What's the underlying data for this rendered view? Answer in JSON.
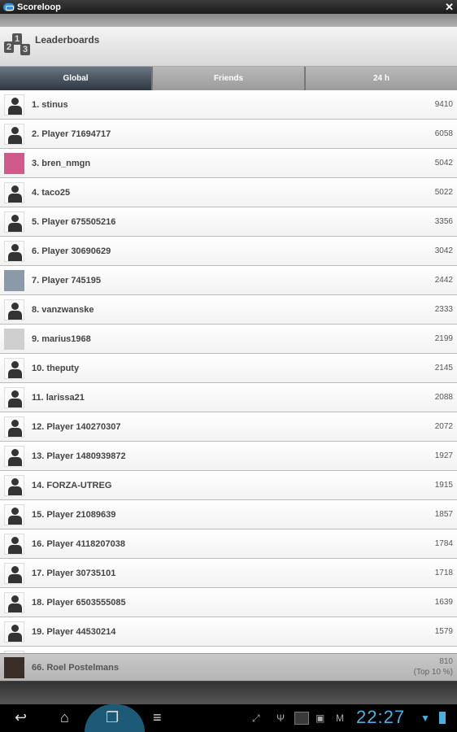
{
  "app": {
    "title": "Scoreloop",
    "close_icon": "close-icon"
  },
  "header": {
    "title": "Leaderboards",
    "icon_digits": [
      "2",
      "1",
      "3"
    ]
  },
  "tabs": [
    {
      "label": "Global",
      "active": true
    },
    {
      "label": "Friends",
      "active": false
    },
    {
      "label": "24 h",
      "active": false
    }
  ],
  "rows": [
    {
      "name": "1. stinus",
      "score": "9410",
      "avatar": "default"
    },
    {
      "name": "2. Player 71694717",
      "score": "6058",
      "avatar": "default"
    },
    {
      "name": "3. bren_nmgn",
      "score": "5042",
      "avatar": "photo",
      "color": "#d05a8a"
    },
    {
      "name": "4. taco25",
      "score": "5022",
      "avatar": "default"
    },
    {
      "name": "5. Player 675505216",
      "score": "3356",
      "avatar": "default"
    },
    {
      "name": "6. Player 30690629",
      "score": "3042",
      "avatar": "default"
    },
    {
      "name": "7. Player 745195",
      "score": "2442",
      "avatar": "photo",
      "color": "#8a9aa8"
    },
    {
      "name": "8. vanzwanske",
      "score": "2333",
      "avatar": "default"
    },
    {
      "name": "9. marius1968",
      "score": "2199",
      "avatar": "photo",
      "color": "#cfcfcf"
    },
    {
      "name": "10. theputy",
      "score": "2145",
      "avatar": "default"
    },
    {
      "name": "11. larissa21",
      "score": "2088",
      "avatar": "default"
    },
    {
      "name": "12. Player 140270307",
      "score": "2072",
      "avatar": "default"
    },
    {
      "name": "13. Player 1480939872",
      "score": "1927",
      "avatar": "default"
    },
    {
      "name": "14. FORZA-UTREG",
      "score": "1915",
      "avatar": "default"
    },
    {
      "name": "15. Player 21089639",
      "score": "1857",
      "avatar": "default"
    },
    {
      "name": "16. Player 4118207038",
      "score": "1784",
      "avatar": "default"
    },
    {
      "name": "17. Player 30735101",
      "score": "1718",
      "avatar": "default"
    },
    {
      "name": "18. Player 6503555085",
      "score": "1639",
      "avatar": "default"
    },
    {
      "name": "19. Player 44530214",
      "score": "1579",
      "avatar": "default"
    }
  ],
  "my_score": {
    "name": "66. Roel Postelmans",
    "score": "810",
    "rank_note": "(Top 10 %)",
    "avatar": "photo",
    "color": "#3a2e28"
  },
  "system_bar": {
    "time": "22:27",
    "buttons": [
      "back-icon",
      "home-icon",
      "recent-apps-icon",
      "menu-icon"
    ],
    "status_icons": [
      "screen-compat-icon",
      "usb-icon",
      "app-notification-icon",
      "image-icon",
      "gmail-icon",
      "wifi-icon",
      "battery-icon"
    ],
    "accent": "#4ab0e0"
  }
}
